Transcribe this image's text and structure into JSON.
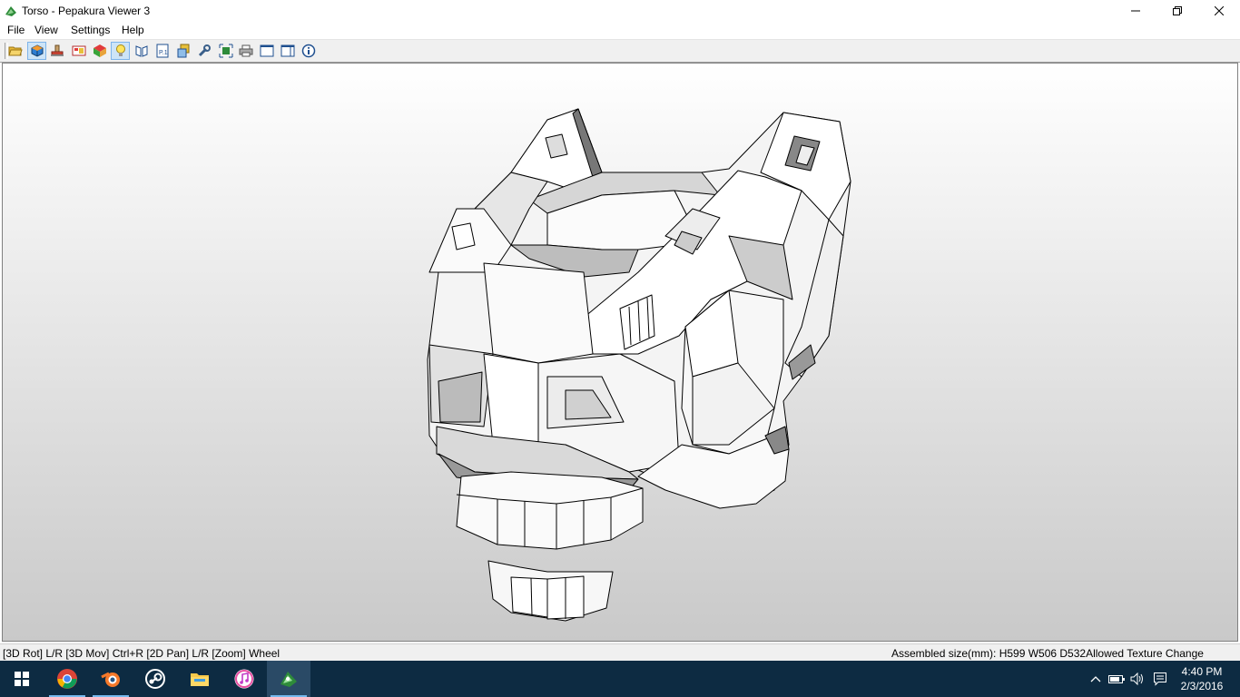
{
  "window": {
    "title": "Torso - Pepakura Viewer 3",
    "app_icon": "pepakura-frog-icon",
    "controls": [
      "minimize-icon",
      "restore-icon",
      "close-icon"
    ]
  },
  "menu": {
    "items": [
      {
        "label": "File"
      },
      {
        "label": "View"
      },
      {
        "label": "Settings"
      },
      {
        "label": "Help"
      }
    ]
  },
  "toolbar": {
    "buttons": [
      {
        "name": "open-folder-icon",
        "active": false
      },
      {
        "name": "3d-model-icon",
        "active": true
      },
      {
        "name": "stamp-icon",
        "active": false
      },
      {
        "name": "texture-icon",
        "active": false
      },
      {
        "name": "color-cube-icon",
        "active": false
      },
      {
        "name": "lightbulb-icon",
        "active": true
      },
      {
        "name": "unfold-icon",
        "active": false
      },
      {
        "name": "page-icon",
        "active": false
      },
      {
        "name": "layers-icon",
        "active": false
      },
      {
        "name": "wrench-icon",
        "active": false
      },
      {
        "name": "fit-view-icon",
        "active": false
      },
      {
        "name": "printer-icon",
        "active": false
      },
      {
        "name": "single-pane-icon",
        "active": false
      },
      {
        "name": "split-pane-icon",
        "active": false
      },
      {
        "name": "info-icon",
        "active": false
      }
    ]
  },
  "status": {
    "hint": "[3D Rot] L/R [3D Mov] Ctrl+R [2D Pan] L/R [Zoom] Wheel",
    "info": "Assembled size(mm): H599 W506 D532Allowed Texture Change"
  },
  "taskbar": {
    "start_icon": "windows-start-icon",
    "apps": [
      {
        "name": "chrome-icon",
        "running": true,
        "active": false
      },
      {
        "name": "blender-icon",
        "running": true,
        "active": false
      },
      {
        "name": "steam-icon",
        "running": false,
        "active": false
      },
      {
        "name": "file-explorer-icon",
        "running": false,
        "active": false
      },
      {
        "name": "itunes-icon",
        "running": false,
        "active": false
      },
      {
        "name": "pepakura-icon",
        "running": true,
        "active": true
      }
    ],
    "tray": [
      "chevron-up-icon",
      "battery-icon",
      "volume-icon",
      "notification-icon"
    ],
    "time": "4:40 PM",
    "date": "2/3/2016"
  }
}
